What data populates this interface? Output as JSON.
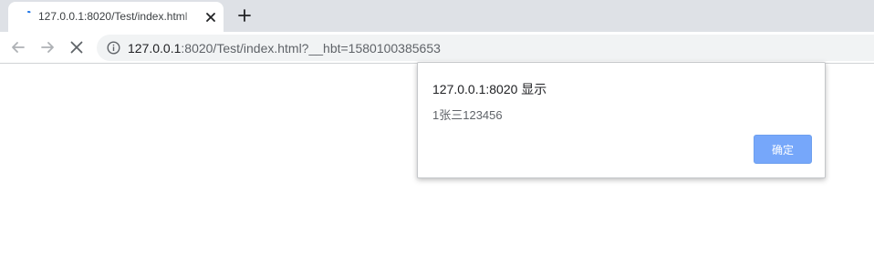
{
  "browser": {
    "tab": {
      "title": "127.0.0.1:8020/Test/index.html",
      "favicon": "loading-spinner-icon",
      "close_icon": "close-icon"
    },
    "new_tab_icon": "plus-icon",
    "nav": {
      "back_icon": "back-arrow-icon",
      "forward_icon": "forward-arrow-icon",
      "stop_icon": "stop-icon"
    },
    "address": {
      "info_icon": "info-icon",
      "host": "127.0.0.1",
      "rest": ":8020/Test/index.html?__hbt=1580100385653"
    }
  },
  "alert": {
    "title": "127.0.0.1:8020 显示",
    "message": "1张三123456",
    "ok_label": "确定",
    "ok_color": "#76a7fa"
  },
  "colors": {
    "tabstrip_bg": "#dee1e6",
    "omnibox_bg": "#f1f3f4",
    "accent": "#1a73e8"
  }
}
